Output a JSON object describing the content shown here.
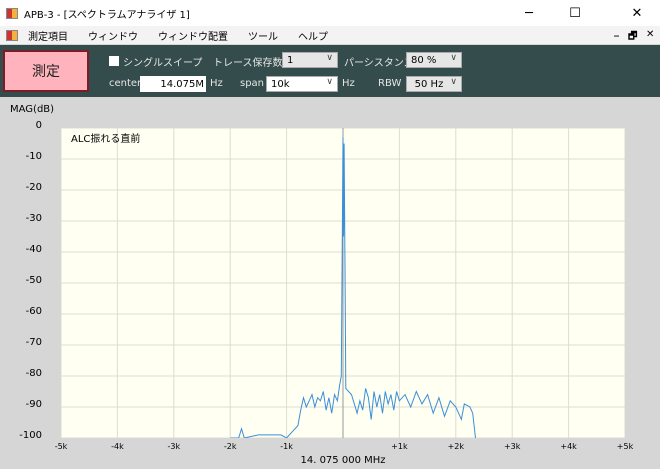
{
  "window": {
    "title": "APB-3 - [スペクトラムアナライザ 1]",
    "minimize": "─",
    "maximize": "☐",
    "close": "✕"
  },
  "menu": {
    "items": [
      "測定項目",
      "ウィンドウ",
      "ウィンドウ配置",
      "ツール",
      "ヘルプ"
    ],
    "mdi_min": "_",
    "mdi_restore": "🗗",
    "mdi_close": "✕"
  },
  "toolbar": {
    "measure_label": "測定",
    "single_sweep": "シングルスイープ",
    "single_sweep_checked": false,
    "trace_keep_label": "トレース保存数",
    "trace_keep_value": "1",
    "persistence_label": "パーシスタンス",
    "persistence_value": "80 %",
    "center_label": "center",
    "center_value": "14.075M",
    "center_unit": "Hz",
    "span_label": "span",
    "span_value": "10k",
    "span_unit": "Hz",
    "rbw_label": "RBW",
    "rbw_value": "50 Hz"
  },
  "chart_data": {
    "type": "line",
    "ylabel": "MAG(dB)",
    "xlabel": "14. 075 000 MHz",
    "annotation": "ALC振れる直前",
    "ylim": [
      -100,
      0
    ],
    "xlim": [
      -5000,
      5000
    ],
    "yticks": [
      "0",
      "-10",
      "-20",
      "-30",
      "-40",
      "-50",
      "-60",
      "-70",
      "-80",
      "-90",
      "-100"
    ],
    "xticks": [
      "-5k",
      "-4k",
      "-3k",
      "-2k",
      "-1k",
      "0",
      "+1k",
      "+2k",
      "+3k",
      "+4k",
      "+5k"
    ],
    "grid": true,
    "trace_color": "#3a8fd8",
    "series": [
      {
        "name": "trace",
        "x": [
          -2000,
          -1850,
          -1800,
          -1750,
          -1500,
          -1300,
          -1100,
          -1000,
          -900,
          -800,
          -750,
          -700,
          -650,
          -600,
          -550,
          -500,
          -450,
          -400,
          -350,
          -300,
          -250,
          -200,
          -150,
          -100,
          -60,
          -30,
          -15,
          0,
          10,
          20,
          35,
          50,
          100,
          150,
          200,
          250,
          300,
          350,
          400,
          450,
          500,
          550,
          600,
          650,
          700,
          750,
          800,
          850,
          900,
          950,
          1000,
          1100,
          1200,
          1300,
          1400,
          1500,
          1600,
          1700,
          1800,
          1900,
          2000,
          2100,
          2150,
          2250,
          2300,
          2350
        ],
        "y": [
          -100,
          -100,
          -97,
          -100,
          -99,
          -99,
          -99,
          -100,
          -98,
          -96,
          -91,
          -87,
          -90,
          -88,
          -86,
          -90,
          -87,
          -88,
          -85,
          -91,
          -87,
          -92,
          -86,
          -88,
          -83,
          -80,
          -40,
          -3,
          -35,
          -5,
          -45,
          -84,
          -85,
          -86,
          -89,
          -92,
          -88,
          -91,
          -84,
          -87,
          -94,
          -85,
          -90,
          -86,
          -92,
          -85,
          -89,
          -86,
          -91,
          -85,
          -88,
          -86,
          -90,
          -85,
          -89,
          -86,
          -92,
          -87,
          -93,
          -88,
          -90,
          -94,
          -89,
          -90,
          -92,
          -100
        ]
      }
    ]
  }
}
